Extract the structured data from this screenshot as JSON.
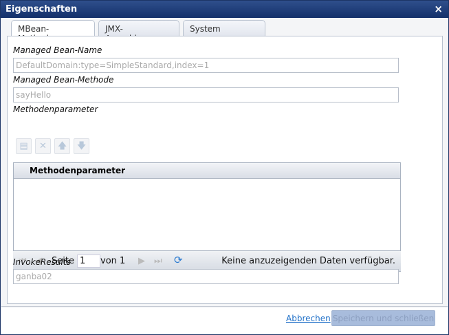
{
  "window": {
    "title": "Eigenschaften",
    "close_icon": "×"
  },
  "tabs": [
    {
      "label": "MBean-Methode..."
    },
    {
      "label": "JMX-Anmeldepa..."
    },
    {
      "label": "System"
    }
  ],
  "form": {
    "bean_name_label": "Managed Bean-Name",
    "bean_name_value": "DefaultDomain:type=SimpleStandard,index=1",
    "bean_method_label": "Managed Bean-Methode",
    "bean_method_value": "sayHello",
    "params_label": "Methodenparameter",
    "invoke_label": "InvokeResults",
    "invoke_value": "ganba02"
  },
  "grid": {
    "column": "Methodenparameter"
  },
  "pager": {
    "page_label": "Seite",
    "page": "1",
    "of_label": "von 1",
    "status": "Keine anzuzeigenden Daten verfügbar."
  },
  "footer": {
    "cancel": "Abbrechen",
    "save": "Speichern und schließen"
  }
}
